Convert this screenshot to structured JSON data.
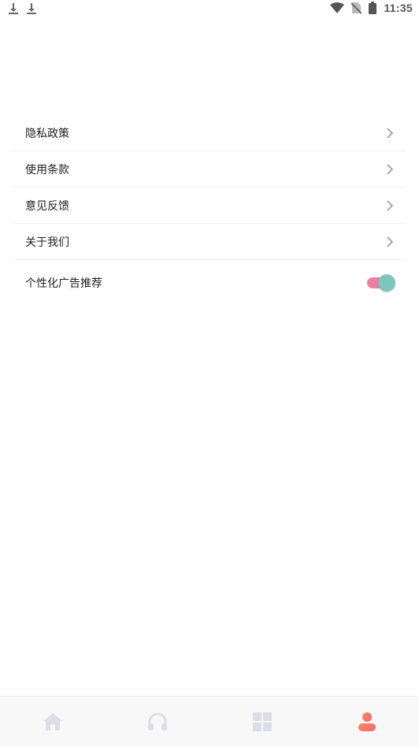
{
  "status_bar": {
    "time": "11:35",
    "left_icons": [
      "download-icon",
      "download-icon"
    ],
    "right_icons": [
      "wifi-icon",
      "no-sim-icon",
      "battery-icon"
    ]
  },
  "settings": {
    "items": [
      {
        "label": "隐私政策",
        "icon": "chevron-right-icon"
      },
      {
        "label": "使用条款",
        "icon": "chevron-right-icon"
      },
      {
        "label": "意见反馈",
        "icon": "chevron-right-icon"
      },
      {
        "label": "关于我们",
        "icon": "chevron-right-icon"
      }
    ],
    "toggle_item": {
      "label": "个性化广告推荐",
      "enabled": true
    }
  },
  "bottom_nav": {
    "items": [
      {
        "icon": "home-icon",
        "active": false
      },
      {
        "icon": "headphones-icon",
        "active": false
      },
      {
        "icon": "grid-icon",
        "active": false
      },
      {
        "icon": "profile-icon",
        "active": true
      }
    ]
  },
  "colors": {
    "toggle_track": "#f07ea0",
    "toggle_knob": "#7cc6bd",
    "nav_inactive": "#dcdde8",
    "nav_active": "#f77560"
  }
}
